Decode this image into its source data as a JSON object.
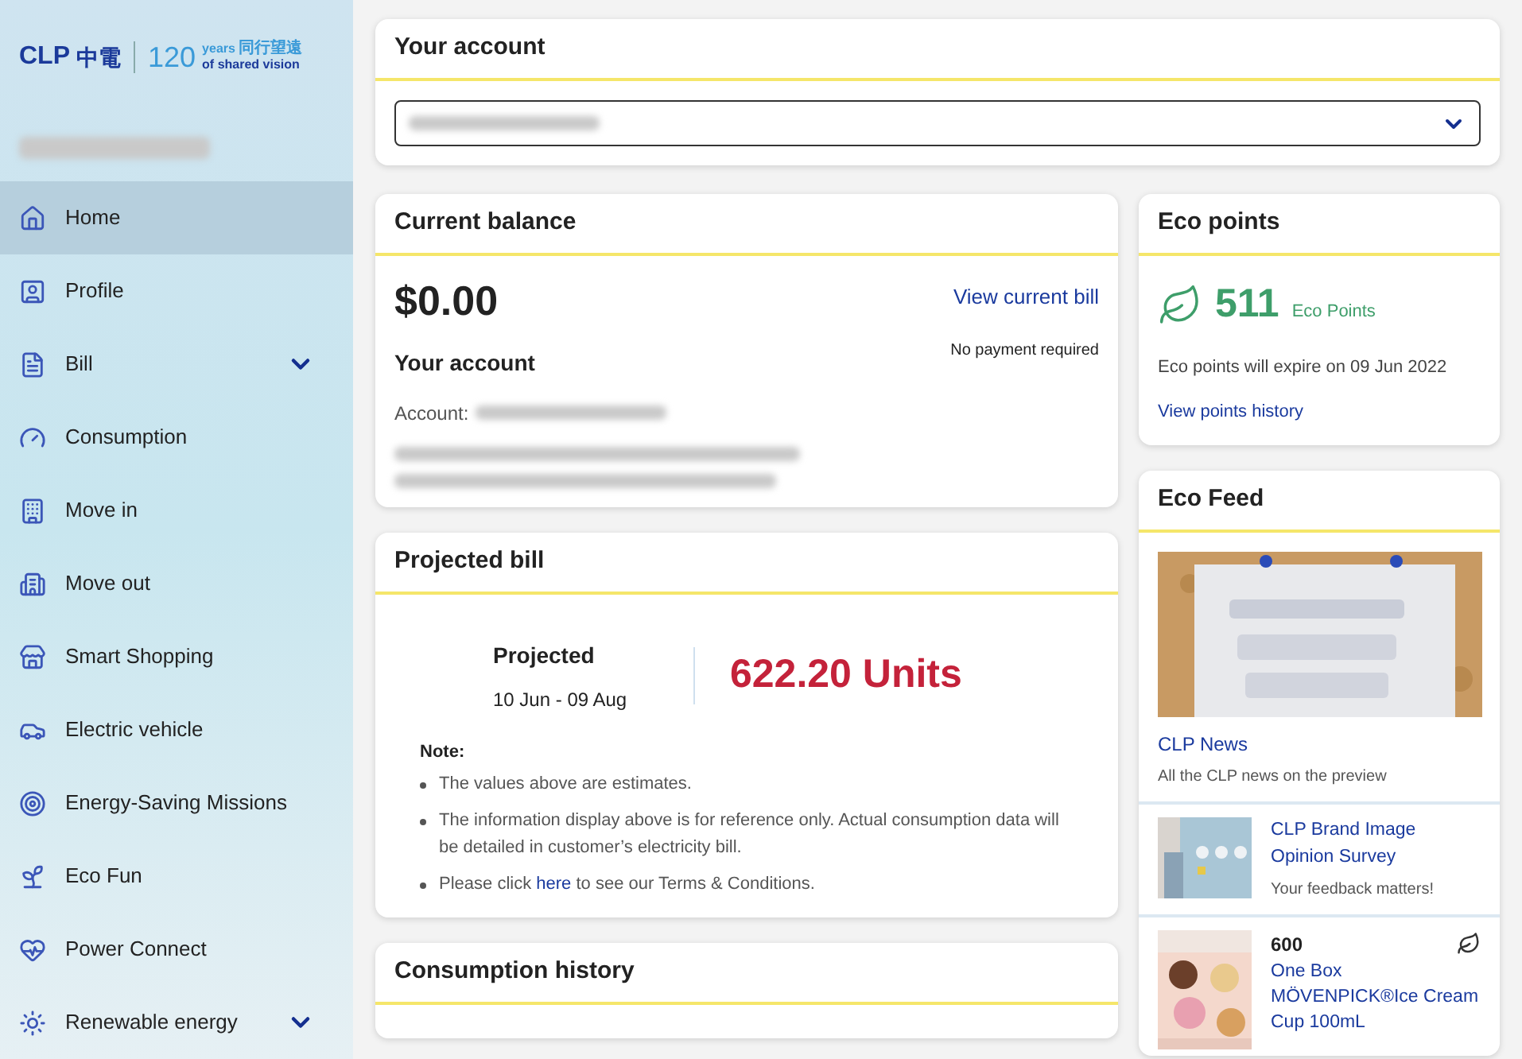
{
  "logo": {
    "brand": "CLP",
    "brand_cn": "中電",
    "anniversary": "120",
    "years": "years",
    "years_cn": "同行望遠",
    "tagline": "of shared vision"
  },
  "sidebar": {
    "items": [
      {
        "label": "Home",
        "selected": true,
        "expandable": false
      },
      {
        "label": "Profile",
        "selected": false,
        "expandable": false
      },
      {
        "label": "Bill",
        "selected": false,
        "expandable": true
      },
      {
        "label": "Consumption",
        "selected": false,
        "expandable": false
      },
      {
        "label": "Move in",
        "selected": false,
        "expandable": false
      },
      {
        "label": "Move out",
        "selected": false,
        "expandable": false
      },
      {
        "label": "Smart Shopping",
        "selected": false,
        "expandable": false
      },
      {
        "label": "Electric vehicle",
        "selected": false,
        "expandable": false
      },
      {
        "label": "Energy-Saving Missions",
        "selected": false,
        "expandable": false
      },
      {
        "label": "Eco Fun",
        "selected": false,
        "expandable": false
      },
      {
        "label": "Power Connect",
        "selected": false,
        "expandable": false
      },
      {
        "label": "Renewable energy",
        "selected": false,
        "expandable": true
      }
    ]
  },
  "account_select": {
    "title": "Your account"
  },
  "balance": {
    "title": "Current balance",
    "amount": "$0.00",
    "link": "View current bill",
    "status": "No payment required",
    "subtitle": "Your account",
    "account_label": "Account:"
  },
  "projected": {
    "title": "Projected bill",
    "label": "Projected",
    "period": "10 Jun - 09 Aug",
    "units": "622.20 Units",
    "note_title": "Note:",
    "notes": [
      {
        "text": "The values above are estimates."
      },
      {
        "text": "The information display above is for reference only. Actual consumption data will be detailed in customer’s electricity bill."
      },
      {
        "text": "Please click ",
        "link": "here",
        "after": " to see our Terms & Conditions."
      }
    ]
  },
  "consumption": {
    "title": "Consumption history"
  },
  "eco_points": {
    "title": "Eco points",
    "points": "511",
    "unit": "Eco Points",
    "expiry": "Eco points will expire on 09 Jun 2022",
    "link": "View points history"
  },
  "eco_feed": {
    "title": "Eco Feed",
    "items": [
      {
        "kind": "banner",
        "title": "CLP News",
        "subtitle": "All the CLP news on the preview"
      },
      {
        "kind": "thumb",
        "title": "CLP Brand Image Opinion Survey",
        "subtitle": "Your feedback matters!"
      },
      {
        "kind": "reward",
        "points": "600",
        "title": "One Box MÖVENPICK®Ice Cream Cup 100mL"
      }
    ]
  }
}
